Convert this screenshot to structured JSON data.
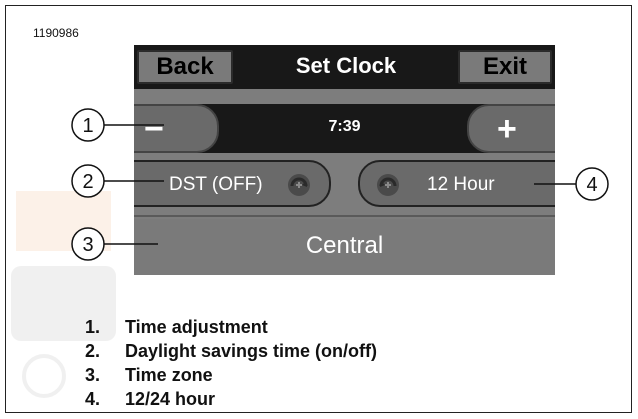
{
  "figure_id": "1190986",
  "screen": {
    "title": "Set Clock",
    "back_label": "Back",
    "exit_label": "Exit",
    "minus_label": "−",
    "plus_label": "+",
    "time": "7:39",
    "dst_label": "DST (OFF)",
    "hour_label": "12 Hour",
    "zone_label": "Central"
  },
  "callouts": [
    "1",
    "2",
    "3",
    "4"
  ],
  "legend": [
    {
      "num": "1.",
      "text": "Time adjustment"
    },
    {
      "num": "2.",
      "text": "Daylight savings time (on/off)"
    },
    {
      "num": "3.",
      "text": "Time zone"
    },
    {
      "num": "4.",
      "text": "12/24 hour"
    }
  ],
  "colors": {
    "screen_bg": "#7d7d7d",
    "bar_dark": "#181818",
    "button_gray": "#6a6a6a",
    "text_white": "#ffffff"
  }
}
